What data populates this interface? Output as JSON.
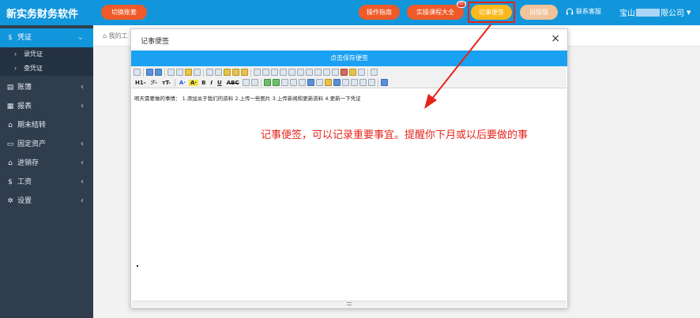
{
  "app": {
    "brand": "新实务财务软件"
  },
  "topbar": {
    "switch_account": "切换账套",
    "guide": "操作指南",
    "course": "实操课程大全",
    "hot_badge": "HOT",
    "note": "记事便签",
    "old_version": "旧版版",
    "service": "联系客服",
    "company_prefix": "宝山",
    "company_suffix": "限公司"
  },
  "sidebar": {
    "items": [
      {
        "label": "凭证",
        "icon": "dollar-icon",
        "active": true
      },
      {
        "label": "账簿",
        "icon": "book-icon"
      },
      {
        "label": "报表",
        "icon": "report-icon"
      },
      {
        "label": "期末结转",
        "icon": "transfer-icon"
      },
      {
        "label": "固定资产",
        "icon": "monitor-icon"
      },
      {
        "label": "进销存",
        "icon": "cart-icon"
      },
      {
        "label": "工资",
        "icon": "dollar-icon"
      },
      {
        "label": "设置",
        "icon": "settings-icon"
      }
    ],
    "subitems": [
      "录凭证",
      "查凭证"
    ]
  },
  "breadcrumb": {
    "text": "我的工"
  },
  "dialog": {
    "title": "记事便签",
    "save_bar": "点击保存便签",
    "toolbar_heading": "H1-",
    "toolbar_font": "ℱ-",
    "toolbar_size": "тT-",
    "editor_text": "明天需要做的事情： 1.添加关于我们的资料 2.上传一些图片 3.上传新闻和更新资料 4.更新一下凭证"
  },
  "annotation": {
    "text": "记事便签，可以记录重要事宜。提醒你下月或以后要做的事",
    "color": "#e5241b"
  },
  "colors": {
    "topbar": "#1296db",
    "sidebar": "#2f3d4d",
    "pill_orange": "#f05a28",
    "pill_yellow": "#f9b91e",
    "save_bar": "#1ba1f2"
  }
}
